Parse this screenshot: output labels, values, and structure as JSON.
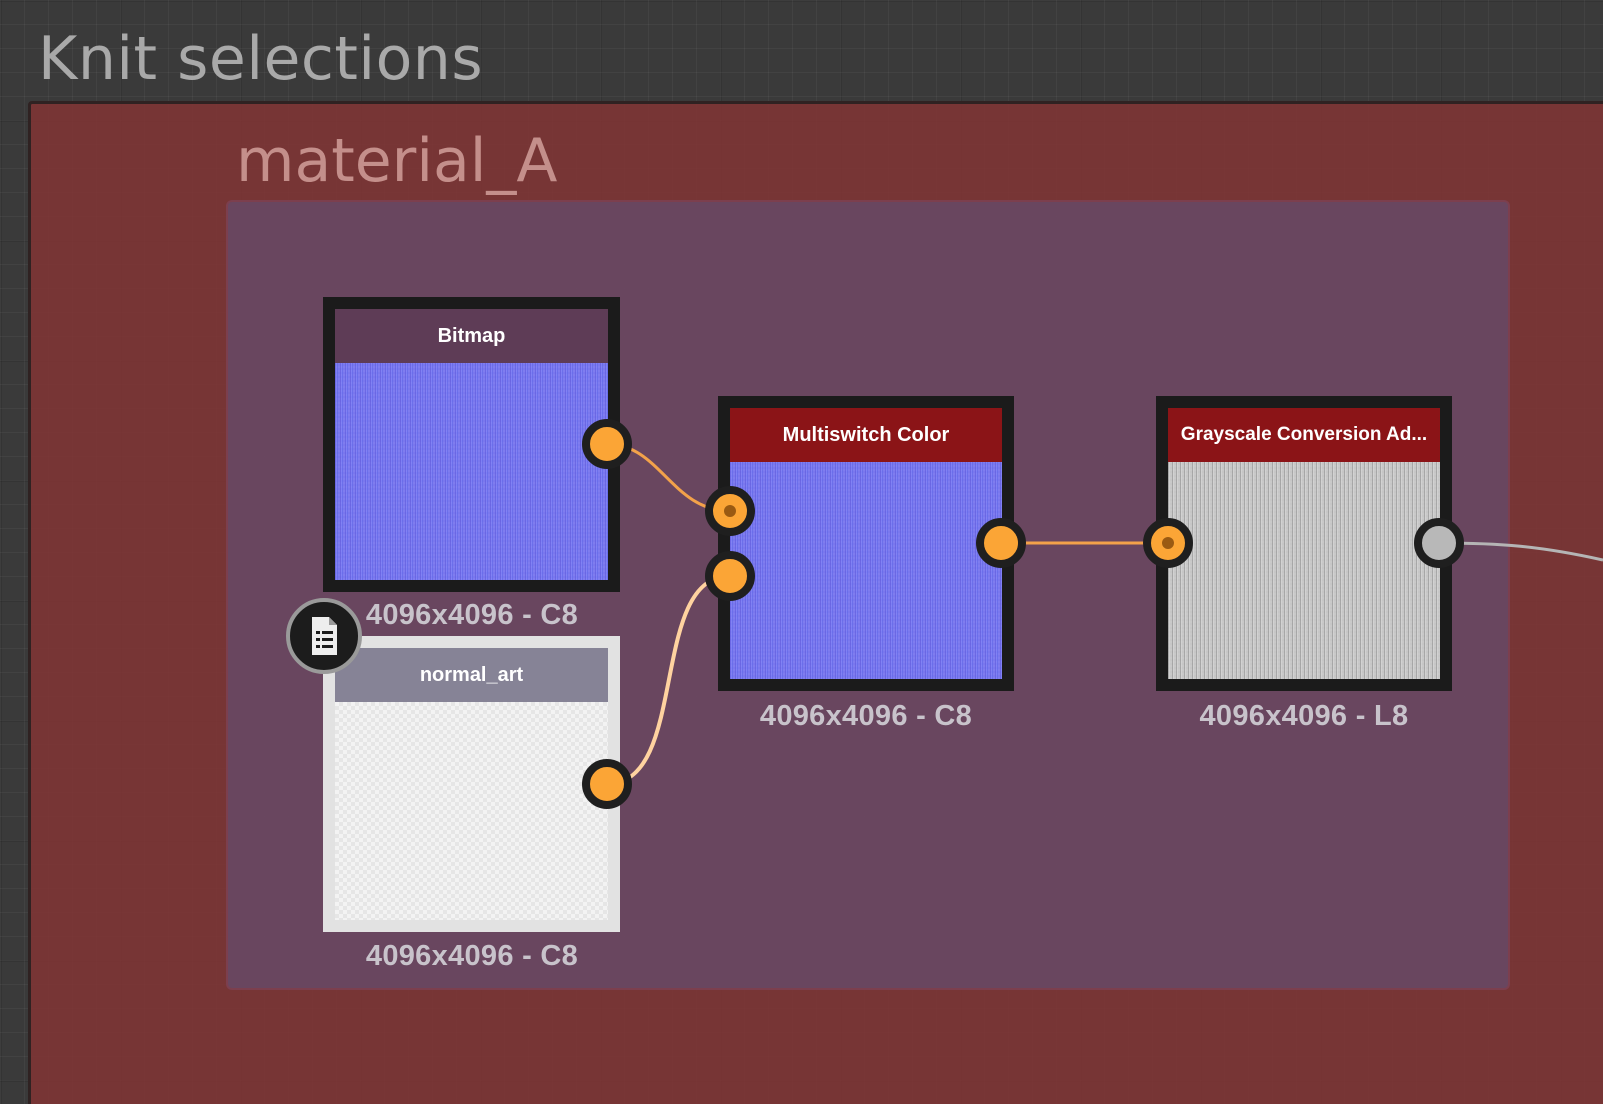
{
  "graph": {
    "outer_frame": {
      "title": "Knit selections"
    },
    "inner_frame": {
      "title": "material_A"
    },
    "nodes": [
      {
        "id": "bitmap",
        "title": "Bitmap",
        "info": "4096x4096 - C8"
      },
      {
        "id": "normal_art",
        "title": "normal_art",
        "info": "4096x4096 - C8"
      },
      {
        "id": "multiswitch",
        "title": "Multiswitch Color",
        "info": "4096x4096 - C8"
      },
      {
        "id": "grayscale",
        "title": "Grayscale Conversion Ad...",
        "info": "4096x4096 - L8"
      }
    ]
  },
  "icons": {
    "comment": "document-lines-icon",
    "port": "circle-port-icon"
  },
  "colors": {
    "outer_frame_bg": "#803434",
    "inner_frame_bg": "#684862",
    "header_red": "#8b1417",
    "header_bitmap": "#5e3c56",
    "header_normal_art": "#868396",
    "port_orange": "#fba536",
    "port_gray": "#b8b8b8",
    "wire_orange": "#f3a24a",
    "wire_light": "#ffd3a0",
    "wire_gray": "#b5b5b5"
  }
}
